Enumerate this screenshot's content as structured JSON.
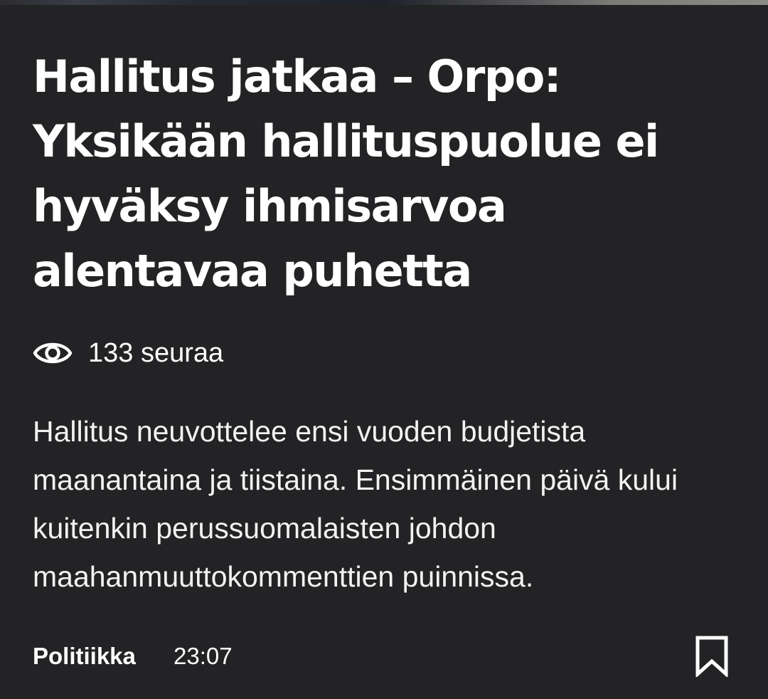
{
  "article": {
    "headline": "Hallitus jatkaa – Orpo: Yksikään hallituspuolue ei hyväksy ihmisarvoa alentavaa puhetta",
    "followers_text": "133 seuraa",
    "lead": "Hallitus neuvottelee ensi vuoden budjetista maanantaina ja tiistaina. Ensimmäinen päivä kului kuitenkin perussuomalaisten johdon maahanmuuttokommenttien puinnissa.",
    "category": "Politiikka",
    "time": "23:07"
  },
  "icons": {
    "followers": "eye-icon",
    "save": "bookmark-icon"
  },
  "colors": {
    "background": "#232325",
    "text": "#ffffff"
  }
}
